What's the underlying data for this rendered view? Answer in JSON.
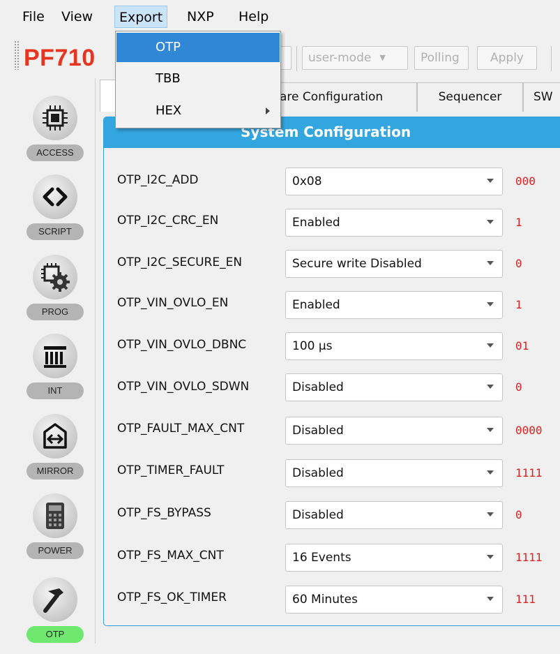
{
  "menubar": {
    "items": [
      {
        "label": "File"
      },
      {
        "label": "View"
      },
      {
        "label": "Export"
      },
      {
        "label": "NXP"
      },
      {
        "label": "Help"
      }
    ]
  },
  "toolbar": {
    "brand": "PF710",
    "mode_combo": "user-mode",
    "polling_label": "Polling",
    "apply_label": "Apply"
  },
  "sidebar": {
    "items": [
      {
        "label": "ACCESS",
        "icon": "chip-icon"
      },
      {
        "label": "SCRIPT",
        "icon": "code-brackets-icon"
      },
      {
        "label": "PROG",
        "icon": "chip-gear-icon"
      },
      {
        "label": "INT",
        "icon": "pillars-icon"
      },
      {
        "label": "MIRROR",
        "icon": "mirror-icon"
      },
      {
        "label": "POWER",
        "icon": "calculator-icon"
      },
      {
        "label": "OTP",
        "icon": "hammer-icon",
        "active": true
      }
    ]
  },
  "tabs": [
    {
      "label": "",
      "selected": true
    },
    {
      "label": "are Configuration"
    },
    {
      "label": "Sequencer"
    },
    {
      "label": "SW"
    }
  ],
  "panel": {
    "title": "System Configuration",
    "rows": [
      {
        "name": "OTP_I2C_ADD",
        "value": "0x08",
        "bits": "000"
      },
      {
        "name": "OTP_I2C_CRC_EN",
        "value": "Enabled",
        "bits": "1"
      },
      {
        "name": "OTP_I2C_SECURE_EN",
        "value": "Secure write Disabled",
        "bits": "0"
      },
      {
        "name": "OTP_VIN_OVLO_EN",
        "value": "Enabled",
        "bits": "1"
      },
      {
        "name": "OTP_VIN_OVLO_DBNC",
        "value": "100 µs",
        "bits": "01"
      },
      {
        "name": "OTP_VIN_OVLO_SDWN",
        "value": "Disabled",
        "bits": "0"
      },
      {
        "name": "OTP_FAULT_MAX_CNT",
        "value": "Disabled",
        "bits": "0000"
      },
      {
        "name": "OTP_TIMER_FAULT",
        "value": "Disabled",
        "bits": "1111"
      },
      {
        "name": "OTP_FS_BYPASS",
        "value": "Disabled",
        "bits": "0"
      },
      {
        "name": "OTP_FS_MAX_CNT",
        "value": "16 Events",
        "bits": "1111"
      },
      {
        "name": "OTP_FS_OK_TIMER",
        "value": "60 Minutes",
        "bits": "111"
      }
    ]
  },
  "export_menu": {
    "items": [
      {
        "label": "OTP",
        "highlighted": true
      },
      {
        "label": "TBB"
      },
      {
        "label": "HEX",
        "submenu": true
      }
    ]
  },
  "colors": {
    "brand": "#e5341f",
    "panel_header": "#33a6df",
    "bits": "#e01f1f",
    "menu_highlight": "#2f87d6",
    "active_nav": "#6ee86e"
  }
}
